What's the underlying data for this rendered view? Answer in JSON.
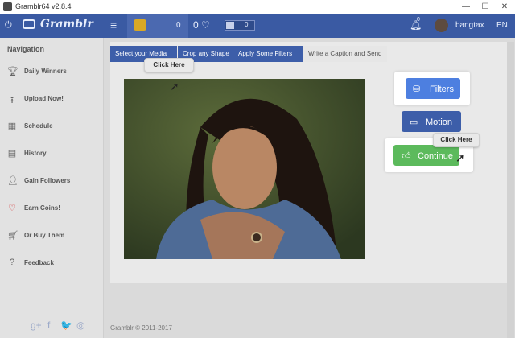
{
  "window": {
    "title": "Gramblr64 v2.8.4",
    "controls": [
      "—",
      "☐",
      "✕"
    ]
  },
  "header": {
    "logo_text": "Gramblr",
    "coins": "0",
    "likes_label": "0 ♡",
    "likes_value": "0",
    "notifications": "0",
    "username": "bangtax",
    "language": "EN"
  },
  "sidebar": {
    "heading": "Navigation",
    "items": [
      {
        "label": "Daily Winners",
        "icon": "trophy-icon"
      },
      {
        "label": "Upload Now!",
        "icon": "upload-icon"
      },
      {
        "label": "Schedule",
        "icon": "calendar-icon"
      },
      {
        "label": "History",
        "icon": "history-icon"
      },
      {
        "label": "Gain Followers",
        "icon": "user-icon"
      },
      {
        "label": "Earn Coins!",
        "icon": "heart-icon"
      },
      {
        "label": "Or Buy Them",
        "icon": "cart-icon"
      },
      {
        "label": "Feedback",
        "icon": "help-icon"
      }
    ],
    "social": [
      "g+",
      "f",
      "🐦",
      "◎"
    ]
  },
  "steps": [
    {
      "label": "Select your Media",
      "state": "done"
    },
    {
      "label": "Crop any Shape",
      "state": "done"
    },
    {
      "label": "Apply Some Filters",
      "state": "done"
    },
    {
      "label": "Write a Caption and Send",
      "state": "todo"
    }
  ],
  "tooltips": {
    "photo": "Click Here",
    "continue": "Click Here"
  },
  "buttons": {
    "filters": {
      "label": "Filters",
      "color": "#4d7fe0"
    },
    "motion": {
      "label": "Motion",
      "color": "#3d5ea9"
    },
    "continue": {
      "label": "Continue",
      "color": "#5cba5c"
    }
  },
  "footer": {
    "copyright": "Gramblr © 2011-2017"
  },
  "colors": {
    "accent": "#3a5aa3",
    "sidebar_bg": "#e2e2e2",
    "heart": "#d63b3b"
  }
}
